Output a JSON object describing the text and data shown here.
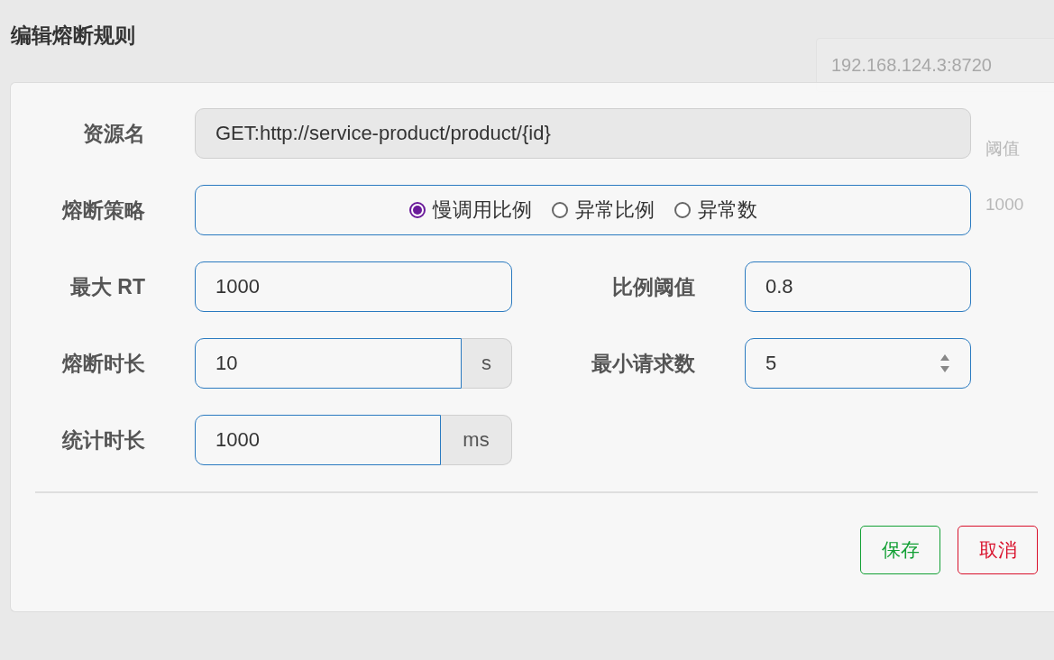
{
  "background": {
    "address_field": {
      "value": "192.168.124.3:8720"
    },
    "table_header": [
      "阈值"
    ],
    "table_row": [
      "1000"
    ]
  },
  "dialog": {
    "title": "编辑熔断规则",
    "resource": {
      "label": "资源名",
      "value": "GET:http://service-product/product/{id}"
    },
    "strategy": {
      "label": "熔断策略",
      "options": [
        {
          "label": "慢调用比例",
          "selected": true
        },
        {
          "label": "异常比例",
          "selected": false
        },
        {
          "label": "异常数",
          "selected": false
        }
      ]
    },
    "max_rt": {
      "label": "最大 RT",
      "value": "1000"
    },
    "ratio_threshold": {
      "label": "比例阈值",
      "value": "0.8"
    },
    "break_duration": {
      "label": "熔断时长",
      "value": "10",
      "unit": "s"
    },
    "min_requests": {
      "label": "最小请求数",
      "value": "5"
    },
    "stat_duration": {
      "label": "统计时长",
      "value": "1000",
      "unit": "ms"
    },
    "buttons": [
      {
        "label": "保存",
        "kind": "save"
      },
      {
        "label": "取消",
        "kind": "cancel"
      }
    ]
  }
}
